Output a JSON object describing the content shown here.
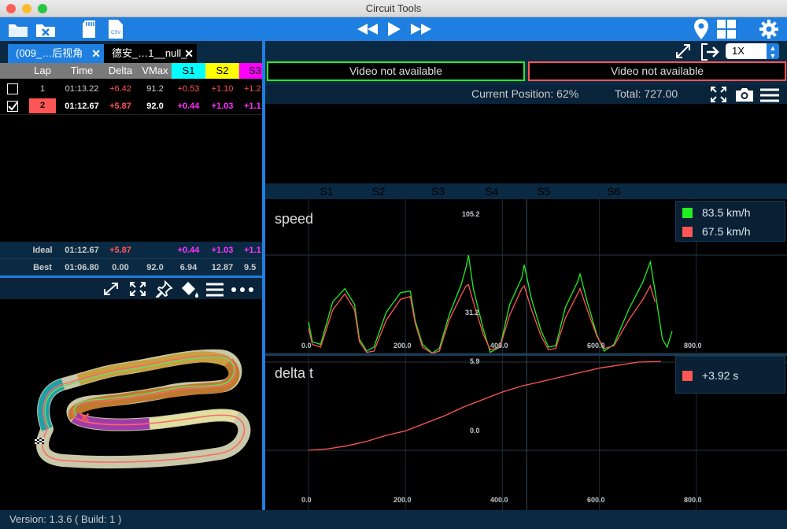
{
  "window": {
    "title": "Circuit Tools"
  },
  "tabs": [
    {
      "label": "(009_…后视角"
    },
    {
      "label": "德安_…1__null_"
    }
  ],
  "table": {
    "columns": [
      "Lap",
      "Time",
      "Delta",
      "VMax",
      "S1",
      "S2",
      "S3"
    ],
    "rows": [
      {
        "lap": "1",
        "time": "01:13.22",
        "delta": "+6.42",
        "vmax": "91.2",
        "s1": "+0.53",
        "s2": "+1.10",
        "s3": "+1.2",
        "checked": false
      },
      {
        "lap": "2",
        "time": "01:12.67",
        "delta": "+5.87",
        "vmax": "92.0",
        "s1": "+0.44",
        "s2": "+1.03",
        "s3": "+1.1",
        "checked": true
      }
    ],
    "ideal": {
      "label": "Ideal",
      "time": "01:12.67",
      "delta": "+5.87",
      "vmax": "",
      "s1": "+0.44",
      "s2": "+1.03",
      "s3": "+1.1"
    },
    "best": {
      "label": "Best",
      "time": "01:06.80",
      "delta": "0.00",
      "vmax": "92.0",
      "s1": "6.94",
      "s2": "12.87",
      "s3": "9.5"
    }
  },
  "video": {
    "left": "Video not available",
    "right": "Video not available",
    "speed": "1X"
  },
  "position": {
    "current": "Current Position: 62%",
    "total": "Total: 727.00"
  },
  "sectors": [
    {
      "label": "S1",
      "color": "#00ffff"
    },
    {
      "label": "S2",
      "color": "#ffff00"
    },
    {
      "label": "S3",
      "color": "#ff00ff"
    },
    {
      "label": "S4",
      "color": "#ff8c00"
    },
    {
      "label": "S5",
      "color": "#b07838"
    },
    {
      "label": "S6",
      "color": "#ffffe0"
    }
  ],
  "colors": {
    "lap1": "#ff5555",
    "lap2": "#22ee22",
    "accent": "#1e7fe0"
  },
  "speed_chart": {
    "title": "speed",
    "max_label": "105.2",
    "min_label": "31.2",
    "x_ticks": [
      "0.0",
      "200.0",
      "400.0",
      "600.0",
      "800.0"
    ],
    "legend": [
      {
        "value": "83.5 km/h",
        "color": "#22ee22"
      },
      {
        "value": "67.5 km/h",
        "color": "#ff5555"
      }
    ]
  },
  "delta_chart": {
    "title": "delta t",
    "max_label": "5.9",
    "zero_label": "0.0",
    "x_ticks": [
      "0.0",
      "200.0",
      "400.0",
      "600.0",
      "800.0"
    ],
    "legend": [
      {
        "value": "+3.92 s",
        "color": "#ff5555"
      }
    ]
  },
  "chart_data": [
    {
      "type": "line",
      "title": "speed",
      "xlim": [
        0,
        1000
      ],
      "ylim": [
        31.2,
        105.2
      ],
      "series": [
        {
          "values": [
            [
              0,
              55
            ],
            [
              8,
              40
            ],
            [
              25,
              38
            ],
            [
              50,
              70
            ],
            [
              75,
              80
            ],
            [
              95,
              68
            ],
            [
              105,
              42
            ],
            [
              120,
              33
            ],
            [
              135,
              36
            ],
            [
              160,
              62
            ],
            [
              190,
              77
            ],
            [
              210,
              78
            ],
            [
              220,
              56
            ],
            [
              235,
              38
            ],
            [
              255,
              31.5
            ],
            [
              270,
              35
            ],
            [
              290,
              60
            ],
            [
              315,
              83
            ],
            [
              325,
              96
            ],
            [
              330,
              105
            ],
            [
              340,
              80
            ],
            [
              360,
              50
            ],
            [
              375,
              32
            ],
            [
              395,
              36
            ],
            [
              415,
              68
            ],
            [
              440,
              88
            ],
            [
              445,
              98
            ],
            [
              460,
              72
            ],
            [
              480,
              48
            ],
            [
              495,
              36
            ],
            [
              510,
              37
            ],
            [
              530,
              66
            ],
            [
              555,
              85
            ],
            [
              560,
              91
            ],
            [
              575,
              70
            ],
            [
              595,
              45
            ],
            [
              610,
              33
            ],
            [
              630,
              38
            ],
            [
              660,
              64
            ],
            [
              690,
              85
            ],
            [
              705,
              100
            ],
            [
              715,
              78
            ],
            [
              730,
              42
            ],
            [
              740,
              36
            ],
            [
              750,
              48
            ]
          ]
        },
        {
          "values": [
            [
              0,
              50
            ],
            [
              8,
              38
            ],
            [
              25,
              36
            ],
            [
              50,
              64
            ],
            [
              75,
              76
            ],
            [
              95,
              64
            ],
            [
              105,
              40
            ],
            [
              120,
              32
            ],
            [
              135,
              33
            ],
            [
              160,
              56
            ],
            [
              190,
              72
            ],
            [
              210,
              74
            ],
            [
              220,
              54
            ],
            [
              235,
              36
            ],
            [
              255,
              31.3
            ],
            [
              270,
              33
            ],
            [
              290,
              56
            ],
            [
              315,
              75
            ],
            [
              325,
              82
            ],
            [
              330,
              83
            ],
            [
              340,
              70
            ],
            [
              360,
              46
            ],
            [
              375,
              34
            ],
            [
              395,
              36
            ],
            [
              415,
              60
            ],
            [
              440,
              80
            ],
            [
              445,
              82
            ],
            [
              460,
              64
            ],
            [
              480,
              44
            ],
            [
              495,
              34
            ],
            [
              510,
              35
            ],
            [
              530,
              58
            ],
            [
              555,
              76
            ],
            [
              560,
              80
            ],
            [
              575,
              64
            ],
            [
              595,
              44
            ],
            [
              610,
              35
            ],
            [
              630,
              37
            ],
            [
              660,
              56
            ],
            [
              690,
              72
            ],
            [
              705,
              82
            ],
            [
              715,
              70
            ]
          ]
        }
      ]
    },
    {
      "type": "line",
      "title": "delta t",
      "xlim": [
        0,
        1000
      ],
      "ylim": [
        -4,
        5.9
      ],
      "series": [
        {
          "values": [
            [
              0,
              0
            ],
            [
              40,
              0.1
            ],
            [
              80,
              0.3
            ],
            [
              120,
              0.6
            ],
            [
              160,
              1.0
            ],
            [
              200,
              1.3
            ],
            [
              240,
              1.8
            ],
            [
              280,
              2.3
            ],
            [
              320,
              2.9
            ],
            [
              360,
              3.4
            ],
            [
              400,
              3.9
            ],
            [
              440,
              4.3
            ],
            [
              480,
              4.6
            ],
            [
              520,
              4.9
            ],
            [
              560,
              5.2
            ],
            [
              600,
              5.5
            ],
            [
              640,
              5.7
            ],
            [
              680,
              5.9
            ],
            [
              727,
              5.95
            ]
          ]
        }
      ]
    }
  ],
  "status": {
    "version": "Version: 1.3.6 ( Build: 1 )"
  }
}
